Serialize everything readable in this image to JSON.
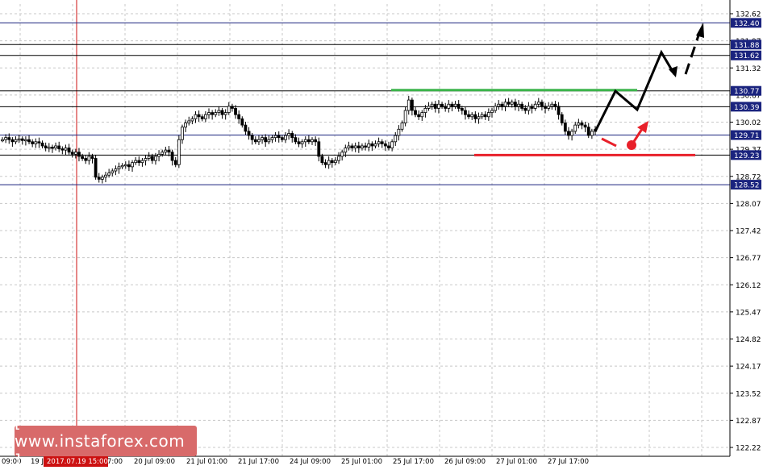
{
  "watermark": {
    "text": "[ www.instaforex.com ]"
  },
  "colors": {
    "background": "#ffffff",
    "grid": "#c8c8c8",
    "level_line": "#1a237e",
    "level_line_black": "#000000",
    "resistance": "#3cb44b",
    "support": "#e8202a",
    "forecast": "#000000",
    "marker": "#d81b60",
    "cursor_line": "#cc1111",
    "price_label_bg": "#1a237e",
    "price_label_text": "#ffffff",
    "axis_text": "#000000",
    "candle": "#000000"
  },
  "chart_data": {
    "type": "candlestick",
    "symbol": "",
    "x_tick_labels": [
      "09:00",
      "19 J",
      "2017.07.19 15:00",
      "7:00",
      "20 Jul 09:00",
      "21 Jul 01:00",
      "21 Jul 17:00",
      "24 Jul 09:00",
      "25 Jul 01:00",
      "25 Jul 17:00",
      "26 Jul 09:00",
      "27 Jul 01:00",
      "27 Jul 17:00"
    ],
    "y_tick_labels": [
      "132.62",
      "131.97",
      "131.32",
      "130.67",
      "130.02",
      "129.37",
      "128.72",
      "128.07",
      "127.42",
      "126.77",
      "126.12",
      "125.47",
      "124.82",
      "124.17",
      "123.52",
      "122.87",
      "122.22"
    ],
    "ylim": [
      122.22,
      132.62
    ],
    "grid": true,
    "levels": [
      {
        "value": 132.4,
        "label": "132.40",
        "style": "blue"
      },
      {
        "value": 131.88,
        "label": "131.88",
        "style": "black"
      },
      {
        "value": 131.62,
        "label": "131.62",
        "style": "black"
      },
      {
        "value": 130.77,
        "label": "130.77",
        "style": "black"
      },
      {
        "value": 130.39,
        "label": "130.39",
        "style": "black"
      },
      {
        "value": 129.71,
        "label": "129.71",
        "style": "blue"
      },
      {
        "value": 129.23,
        "label": "129.23",
        "style": "black"
      },
      {
        "value": 128.52,
        "label": "128.52",
        "style": "blue"
      }
    ],
    "resistance_value": 130.77,
    "support_value": 129.23,
    "crosshair_time_label": "2017.07.19 15:00",
    "price_closes": [
      129.6,
      129.65,
      129.6,
      129.55,
      129.6,
      129.62,
      129.58,
      129.6,
      129.55,
      129.5,
      129.55,
      129.52,
      129.45,
      129.4,
      129.42,
      129.4,
      129.45,
      129.38,
      129.35,
      129.4,
      129.3,
      129.25,
      129.3,
      129.2,
      129.15,
      129.1,
      129.2,
      129.15,
      128.7,
      128.65,
      128.7,
      128.75,
      128.8,
      128.85,
      128.9,
      128.95,
      128.98,
      129.0,
      128.95,
      129.05,
      129.1,
      129.05,
      129.1,
      129.15,
      129.2,
      129.1,
      129.2,
      129.25,
      129.3,
      129.35,
      129.3,
      129.1,
      129.0,
      129.6,
      129.9,
      130.0,
      130.05,
      130.1,
      130.2,
      130.15,
      130.1,
      130.2,
      130.25,
      130.2,
      130.25,
      130.3,
      130.2,
      130.25,
      130.4,
      130.35,
      130.2,
      130.1,
      129.95,
      129.8,
      129.7,
      129.6,
      129.55,
      129.6,
      129.65,
      129.55,
      129.6,
      129.65,
      129.7,
      129.65,
      129.6,
      129.7,
      129.75,
      129.65,
      129.55,
      129.5,
      129.55,
      129.6,
      129.55,
      129.6,
      129.55,
      129.2,
      129.05,
      129.0,
      129.1,
      129.05,
      129.1,
      129.2,
      129.3,
      129.4,
      129.45,
      129.4,
      129.45,
      129.4,
      129.45,
      129.42,
      129.5,
      129.45,
      129.5,
      129.55,
      129.5,
      129.45,
      129.4,
      129.55,
      129.7,
      129.85,
      130.0,
      130.3,
      130.55,
      130.3,
      130.2,
      130.15,
      130.25,
      130.35,
      130.4,
      130.45,
      130.35,
      130.45,
      130.4,
      130.35,
      130.45,
      130.4,
      130.45,
      130.35,
      130.3,
      130.2,
      130.15,
      130.2,
      130.1,
      130.15,
      130.2,
      130.15,
      130.25,
      130.3,
      130.4,
      130.45,
      130.4,
      130.5,
      130.45,
      130.5,
      130.4,
      130.45,
      130.35,
      130.3,
      130.4,
      130.35,
      130.45,
      130.5,
      130.4,
      130.35,
      130.4,
      130.45,
      130.4,
      130.2,
      130.0,
      129.8,
      129.7,
      129.8,
      129.95,
      130.0,
      129.95,
      129.9,
      129.7,
      129.8,
      129.85
    ]
  }
}
